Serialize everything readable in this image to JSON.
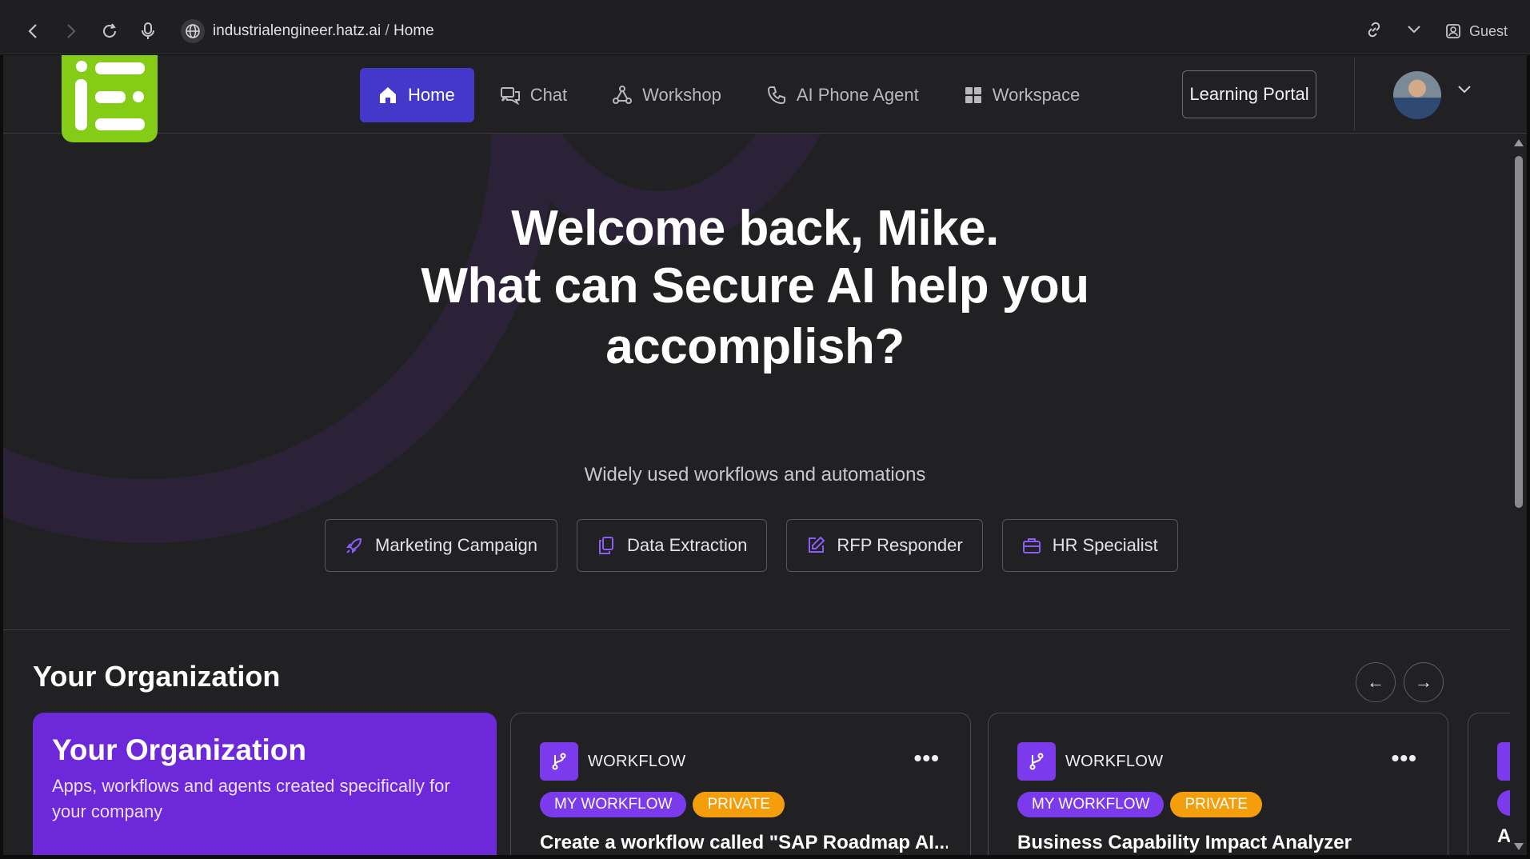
{
  "browser": {
    "url_domain": "industrialengineer.hatz.ai",
    "url_separator": "/",
    "url_page": "Home",
    "profile_label": "Guest"
  },
  "nav": {
    "items": [
      {
        "label": "Home",
        "icon": "home-icon",
        "active": true
      },
      {
        "label": "Chat",
        "icon": "chat-icon"
      },
      {
        "label": "Workshop",
        "icon": "workshop-icon"
      },
      {
        "label": "AI Phone Agent",
        "icon": "phone-icon"
      },
      {
        "label": "Workspace",
        "icon": "grid-icon"
      }
    ],
    "learning_portal": "Learning Portal"
  },
  "hero": {
    "line1": "Welcome back, Mike.",
    "line2": "What can Secure AI help you",
    "line3": "accomplish?",
    "subtitle": "Widely used workflows and automations",
    "quick_actions": [
      {
        "label": "Marketing Campaign",
        "icon": "rocket-icon"
      },
      {
        "label": "Data Extraction",
        "icon": "copy-icon"
      },
      {
        "label": "RFP Responder",
        "icon": "edit-icon"
      },
      {
        "label": "HR Specialist",
        "icon": "briefcase-icon"
      }
    ]
  },
  "organization": {
    "heading": "Your Organization",
    "card_title": "Your Organization",
    "card_desc": "Apps, workflows and agents created specifically for your company",
    "arrow_prev": "←",
    "arrow_next": "→",
    "workflows": [
      {
        "type": "WORKFLOW",
        "badge1": "MY WORKFLOW",
        "badge2": "PRIVATE",
        "title": "Create a workflow called \"SAP Roadmap AI..."
      },
      {
        "type": "WORKFLOW",
        "badge1": "MY WORKFLOW",
        "badge2": "PRIVATE",
        "title": "Business Capability Impact Analyzer"
      }
    ],
    "peek_letter": "A"
  },
  "colors": {
    "accent": "#4338ca",
    "brand_green": "#84cc16",
    "purple": "#7c3aed",
    "badge_yellow": "#f59e0b"
  }
}
